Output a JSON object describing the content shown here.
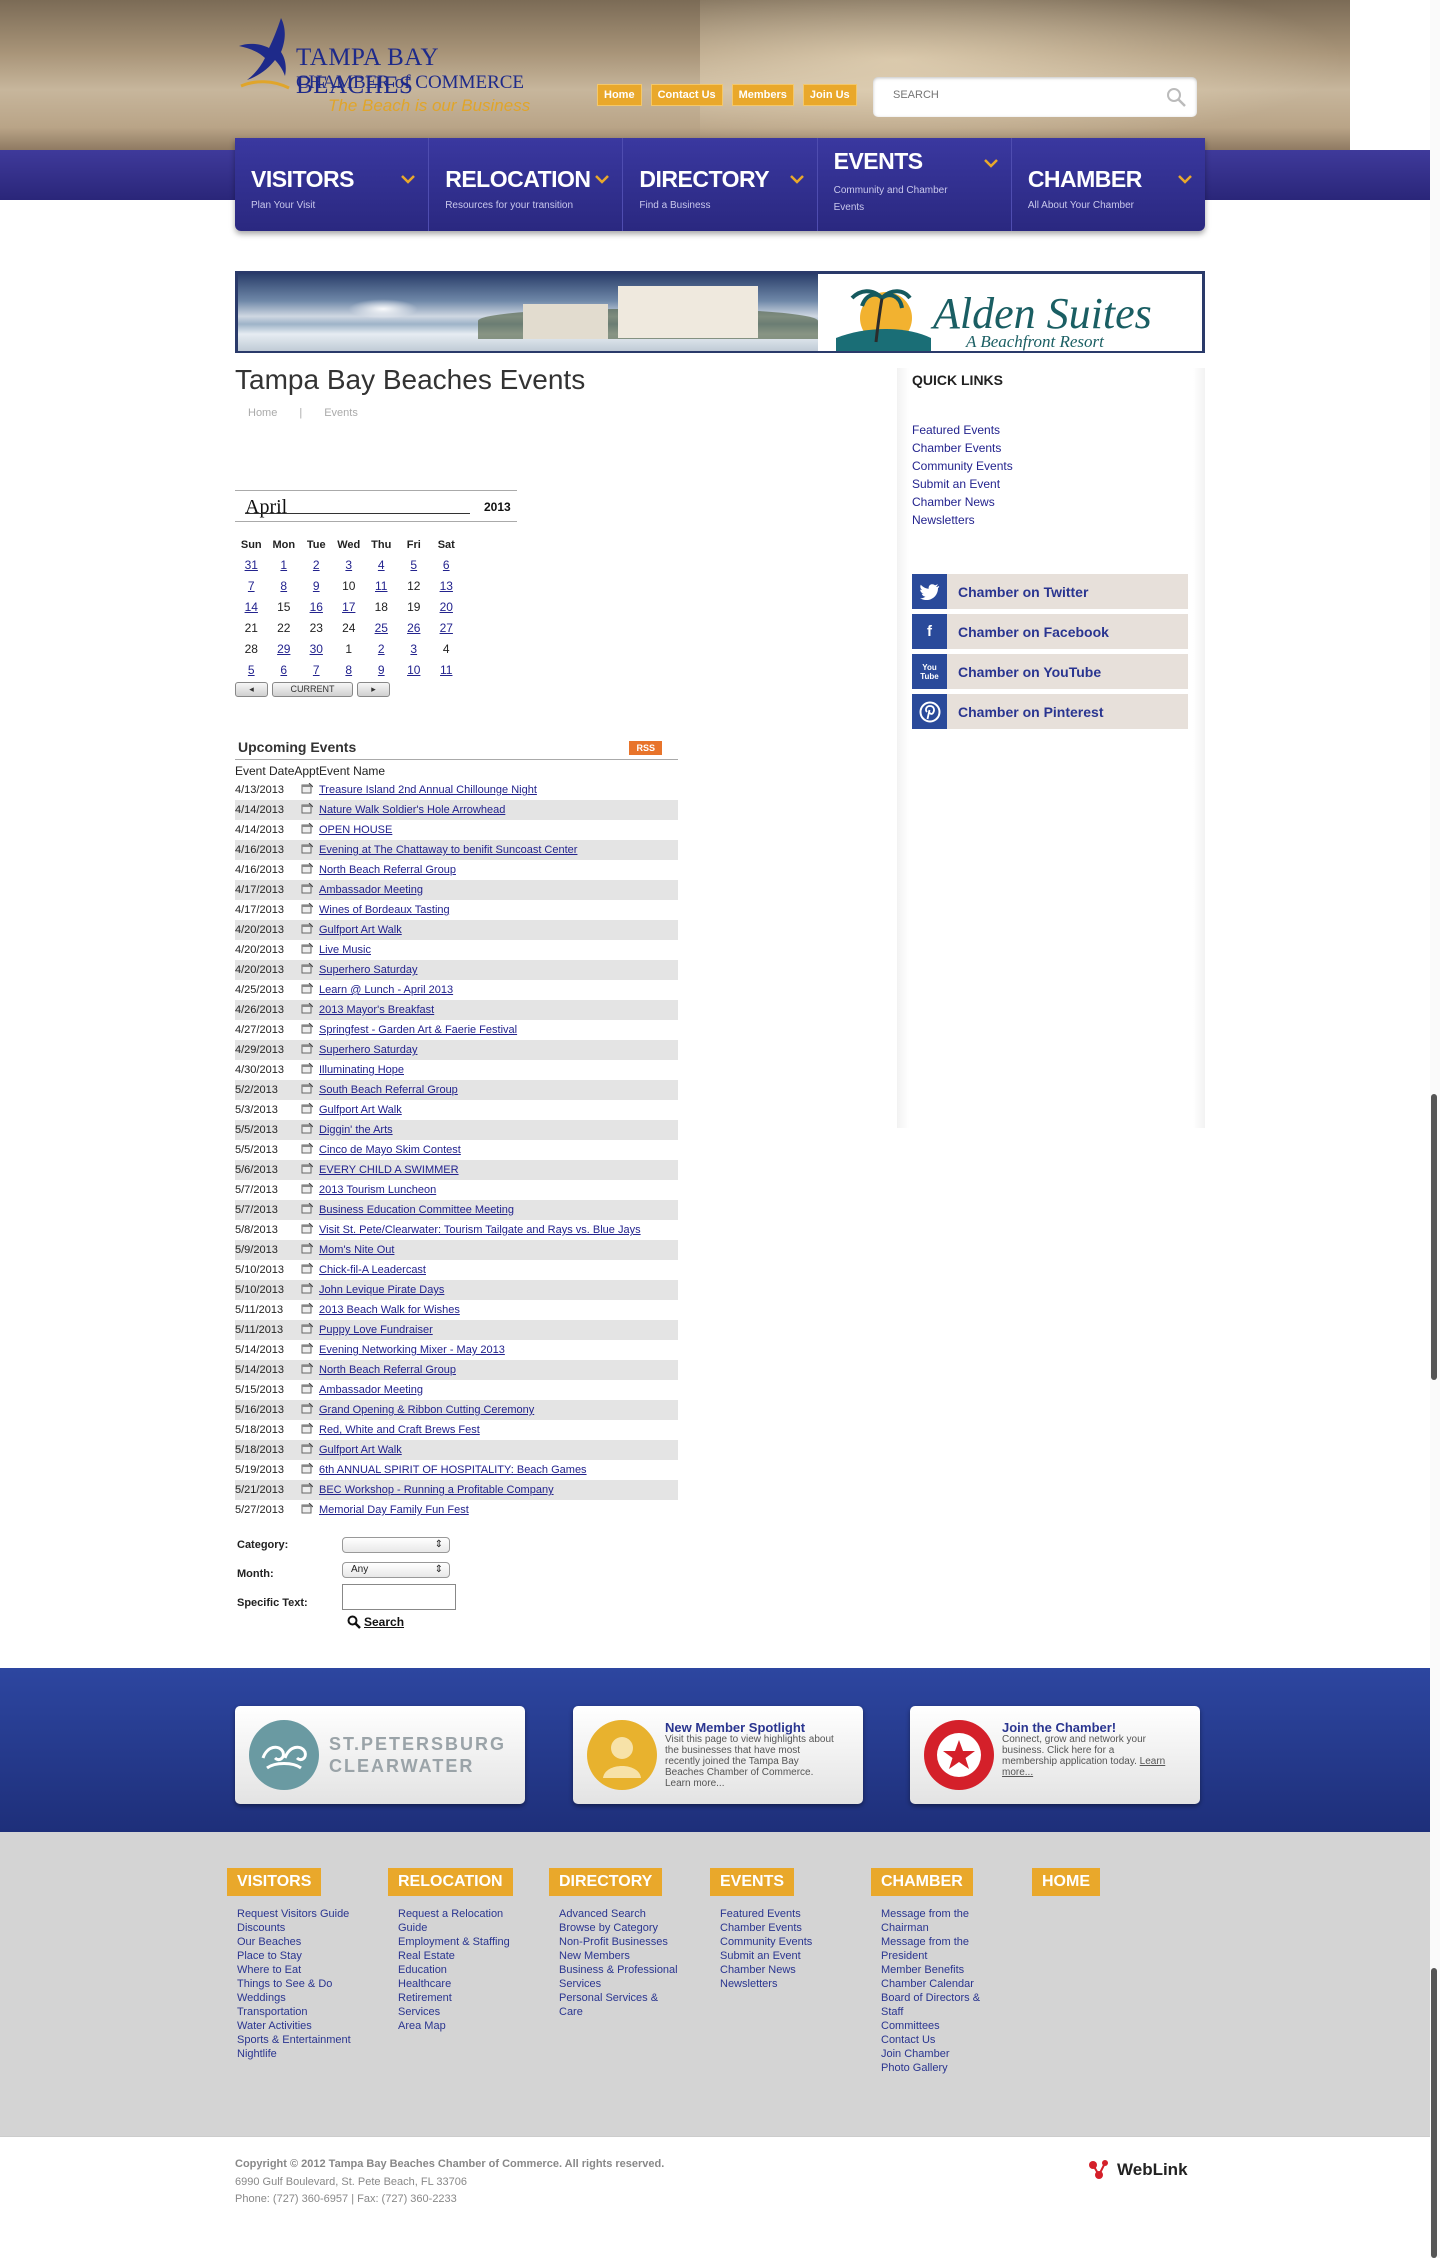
{
  "header": {
    "logo": {
      "line1": "TAMPA BAY BEACHES",
      "line2": "CHAMBER of COMMERCE",
      "tagline": "The Beach is our Business"
    },
    "top_links": [
      "Home",
      "Contact Us",
      "Members",
      "Join Us"
    ],
    "search": {
      "placeholder": "SEARCH"
    }
  },
  "nav": [
    {
      "title": "VISITORS",
      "subtitle": "Plan Your Visit"
    },
    {
      "title": "RELOCATION",
      "subtitle": "Resources for your transition"
    },
    {
      "title": "DIRECTORY",
      "subtitle": "Find a Business"
    },
    {
      "title": "EVENTS",
      "subtitle": "Community and Chamber Events"
    },
    {
      "title": "CHAMBER",
      "subtitle": "All About Your Chamber"
    }
  ],
  "banner": {
    "brand": "Alden Suites",
    "sub": "A Beachfront Resort"
  },
  "page": {
    "title": "Tampa Bay Beaches Events",
    "breadcrumb": [
      "Home",
      "|",
      "Events"
    ]
  },
  "calendar": {
    "month": "April",
    "year": "2013",
    "days": [
      "Sun",
      "Mon",
      "Tue",
      "Wed",
      "Thu",
      "Fri",
      "Sat"
    ],
    "weeks": [
      [
        [
          "31",
          true
        ],
        [
          "1",
          true
        ],
        [
          "2",
          true
        ],
        [
          "3",
          true
        ],
        [
          "4",
          true
        ],
        [
          "5",
          true
        ],
        [
          "6",
          true
        ]
      ],
      [
        [
          "7",
          true
        ],
        [
          "8",
          true
        ],
        [
          "9",
          true
        ],
        [
          "10",
          false
        ],
        [
          "11",
          true
        ],
        [
          "12",
          false
        ],
        [
          "13",
          true
        ]
      ],
      [
        [
          "14",
          true
        ],
        [
          "15",
          false
        ],
        [
          "16",
          true
        ],
        [
          "17",
          true
        ],
        [
          "18",
          false
        ],
        [
          "19",
          false
        ],
        [
          "20",
          true
        ]
      ],
      [
        [
          "21",
          false
        ],
        [
          "22",
          false
        ],
        [
          "23",
          false
        ],
        [
          "24",
          false
        ],
        [
          "25",
          true
        ],
        [
          "26",
          true
        ],
        [
          "27",
          true
        ]
      ],
      [
        [
          "28",
          false
        ],
        [
          "29",
          true
        ],
        [
          "30",
          true
        ],
        [
          "1",
          false
        ],
        [
          "2",
          true
        ],
        [
          "3",
          true
        ],
        [
          "4",
          false
        ]
      ],
      [
        [
          "5",
          true
        ],
        [
          "6",
          true
        ],
        [
          "7",
          true
        ],
        [
          "8",
          true
        ],
        [
          "9",
          true
        ],
        [
          "10",
          true
        ],
        [
          "11",
          true
        ]
      ]
    ],
    "current_label": "CURRENT"
  },
  "events": {
    "heading": "Upcoming Events",
    "rss": "RSS",
    "columns": "Event DateApptEvent Name",
    "items": [
      [
        "4/13/2013",
        "Treasure Island 2nd Annual Chillounge Night"
      ],
      [
        "4/14/2013",
        "Nature Walk Soldier's Hole Arrowhead"
      ],
      [
        "4/14/2013",
        "OPEN HOUSE"
      ],
      [
        "4/16/2013",
        "Evening at The Chattaway to benifit Suncoast Center"
      ],
      [
        "4/16/2013",
        "North Beach Referral Group"
      ],
      [
        "4/17/2013",
        "Ambassador Meeting"
      ],
      [
        "4/17/2013",
        "Wines of Bordeaux Tasting"
      ],
      [
        "4/20/2013",
        "Gulfport Art Walk"
      ],
      [
        "4/20/2013",
        "Live Music"
      ],
      [
        "4/20/2013",
        "Superhero Saturday"
      ],
      [
        "4/25/2013",
        "Learn @ Lunch - April 2013"
      ],
      [
        "4/26/2013",
        "2013 Mayor's Breakfast"
      ],
      [
        "4/27/2013",
        "Springfest - Garden Art & Faerie Festival"
      ],
      [
        "4/29/2013",
        "Superhero Saturday"
      ],
      [
        "4/30/2013",
        "Illuminating Hope"
      ],
      [
        "5/2/2013",
        "South Beach Referral Group"
      ],
      [
        "5/3/2013",
        "Gulfport Art Walk"
      ],
      [
        "5/5/2013",
        "Diggin' the Arts"
      ],
      [
        "5/5/2013",
        "Cinco de Mayo Skim Contest"
      ],
      [
        "5/6/2013",
        "EVERY CHILD A SWIMMER"
      ],
      [
        "5/7/2013",
        "2013 Tourism Luncheon"
      ],
      [
        "5/7/2013",
        "Business Education Committee Meeting"
      ],
      [
        "5/8/2013",
        "Visit St. Pete/Clearwater: Tourism Tailgate and Rays vs. Blue Jays"
      ],
      [
        "5/9/2013",
        "Mom's Nite Out"
      ],
      [
        "5/10/2013",
        "Chick-fil-A Leadercast"
      ],
      [
        "5/10/2013",
        "John Levique Pirate Days"
      ],
      [
        "5/11/2013",
        "2013 Beach Walk for Wishes"
      ],
      [
        "5/11/2013",
        "Puppy Love Fundraiser"
      ],
      [
        "5/14/2013",
        "Evening Networking Mixer - May 2013"
      ],
      [
        "5/14/2013",
        "North Beach Referral Group"
      ],
      [
        "5/15/2013",
        "Ambassador Meeting"
      ],
      [
        "5/16/2013",
        "Grand Opening & Ribbon Cutting Ceremony"
      ],
      [
        "5/18/2013",
        "Red, White and Craft Brews Fest"
      ],
      [
        "5/18/2013",
        "Gulfport Art Walk"
      ],
      [
        "5/19/2013",
        "6th ANNUAL SPIRIT OF HOSPITALITY: Beach Games"
      ],
      [
        "5/21/2013",
        "BEC Workshop - Running a Profitable Company"
      ],
      [
        "5/27/2013",
        "Memorial Day Family Fun Fest"
      ]
    ]
  },
  "filter": {
    "category_label": "Category:",
    "month_label": "Month:",
    "month_value": "Any",
    "text_label": "Specific Text:",
    "search_label": "Search"
  },
  "quick_links": {
    "title": "QUICK LINKS",
    "items": [
      "Featured Events",
      "Chamber Events",
      "Community Events",
      "Submit an Event",
      "Chamber News",
      "Newsletters"
    ],
    "social": [
      "Chamber on Twitter",
      "Chamber on Facebook",
      "Chamber on YouTube",
      "Chamber on Pinterest"
    ]
  },
  "promo": {
    "stpete": [
      "ST.PETERSBURG",
      "CLEARWATER"
    ],
    "spotlight": {
      "title": "New Member Spotlight",
      "body": "Visit this page to view highlights about the businesses that have most recently joined the Tampa Bay Beaches Chamber of Commerce. Learn more..."
    },
    "join": {
      "title": "Join the Chamber!",
      "body": "Connect, grow and network your business. Click here for a membership application today.",
      "link": "Learn more..."
    }
  },
  "footer": {
    "columns": [
      {
        "title": "VISITORS",
        "links": [
          "Request Visitors Guide",
          "Discounts",
          "Our Beaches",
          "Place to Stay",
          "Where to Eat",
          "Things to See & Do",
          "Weddings",
          "Transportation",
          "Water Activities",
          "Sports & Entertainment",
          "Nightlife"
        ]
      },
      {
        "title": "RELOCATION",
        "links": [
          "Request a Relocation",
          "Guide",
          "Employment & Staffing",
          "Real Estate",
          "Education",
          "Healthcare",
          "Retirement",
          "Services",
          "Area Map"
        ]
      },
      {
        "title": "DIRECTORY",
        "links": [
          "Advanced Search",
          "Browse by Category",
          "Non-Profit Businesses",
          "New Members",
          "Business & Professional",
          "Services",
          "Personal Services &",
          "Care"
        ]
      },
      {
        "title": "EVENTS",
        "links": [
          "Featured Events",
          "Chamber Events",
          "Community Events",
          "Submit an Event",
          "Chamber News",
          "Newsletters"
        ]
      },
      {
        "title": "CHAMBER",
        "links": [
          "Message from the",
          "Chairman",
          "Message from the",
          "President",
          "Member Benefits",
          "Chamber Calendar",
          "Board of Directors &",
          "Staff",
          "Committees",
          "Contact Us",
          "Join Chamber",
          "Photo Gallery"
        ]
      },
      {
        "title": "HOME",
        "links": []
      }
    ],
    "copyright": "Copyright © 2012 Tampa Bay Beaches Chamber of Commerce.  All rights reserved.",
    "address": "6990 Gulf Boulevard, St. Pete Beach, FL 33706",
    "phone": "Phone: (727) 360-6957 | Fax: (727) 360-2233",
    "weblink": "WebLink"
  }
}
